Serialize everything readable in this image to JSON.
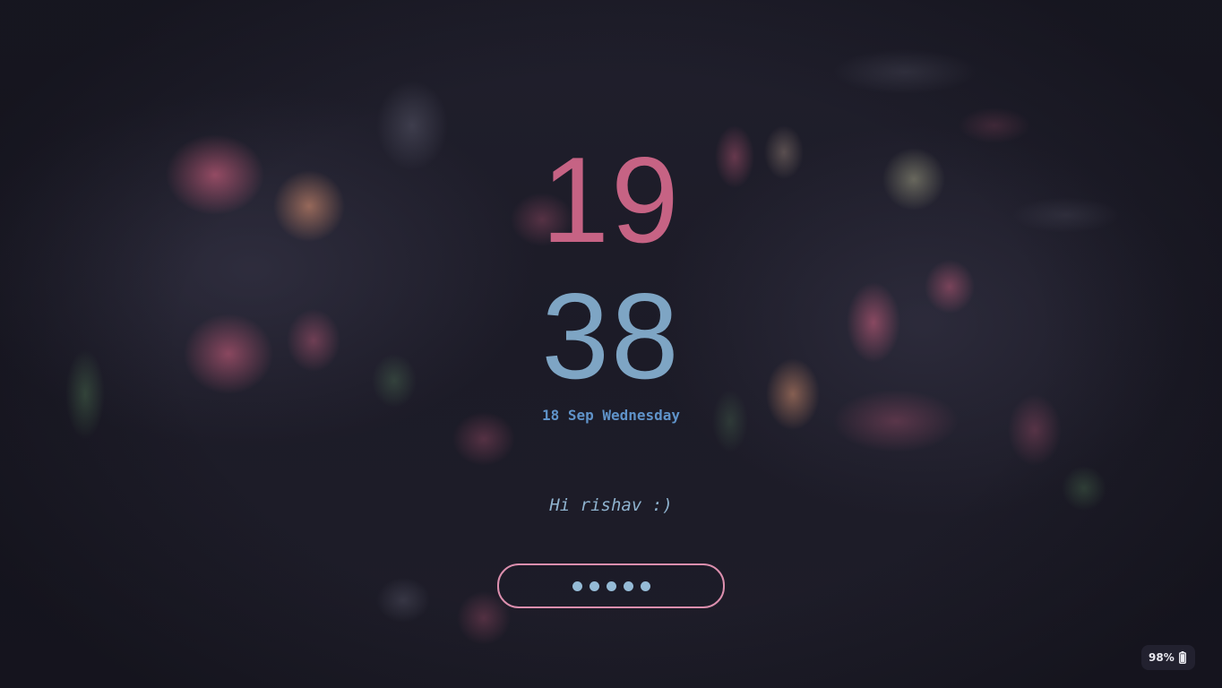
{
  "clock": {
    "hours": "19",
    "minutes": "38"
  },
  "date": {
    "text": "18 Sep Wednesday"
  },
  "greeting": {
    "text": "Hi rishav :)"
  },
  "password": {
    "masked_length": 5
  },
  "battery": {
    "level_text": "98%",
    "level_percent": 98,
    "icon": "battery-icon"
  },
  "colors": {
    "hours": "#c66384",
    "minutes": "#7ea5c4",
    "date": "#5f93c9",
    "greeting": "#8fb3cf",
    "input_border": "#dc8fae",
    "dots": "#95bbd6"
  }
}
